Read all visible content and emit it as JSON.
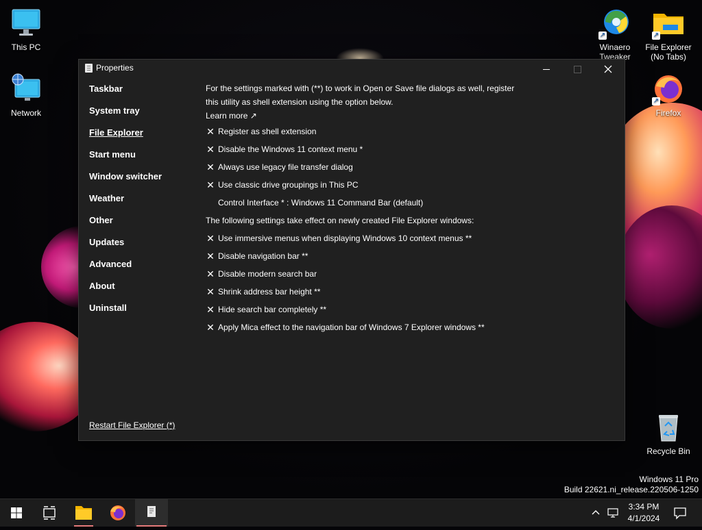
{
  "desktop": {
    "icons": [
      {
        "label": "This PC"
      },
      {
        "label": "Network"
      },
      {
        "label": "Winaero Tweaker"
      },
      {
        "label": "File Explorer (No Tabs)"
      },
      {
        "label": "Firefox"
      },
      {
        "label": "Recycle Bin"
      }
    ],
    "watermark": {
      "line1": "Windows 11 Pro",
      "line2": "Build 22621.ni_release.220506-1250"
    }
  },
  "window": {
    "title": "Properties",
    "nav": [
      {
        "label": "Taskbar",
        "active": false
      },
      {
        "label": "System tray",
        "active": false
      },
      {
        "label": "File Explorer",
        "active": true
      },
      {
        "label": "Start menu",
        "active": false
      },
      {
        "label": "Window switcher",
        "active": false
      },
      {
        "label": "Weather",
        "active": false
      },
      {
        "label": "Other",
        "active": false
      },
      {
        "label": "Updates",
        "active": false
      },
      {
        "label": "Advanced",
        "active": false
      },
      {
        "label": "About",
        "active": false
      },
      {
        "label": "Uninstall",
        "active": false
      }
    ],
    "restart_link": "Restart File Explorer (*)",
    "content": {
      "intro": "For the settings marked with (**) to work in Open or Save file dialogs as well, register this utility as shell extension using the option below.",
      "learn_more": "Learn more ↗",
      "group1": [
        {
          "label": "Register as shell extension",
          "mark": "✕"
        },
        {
          "label": "Disable the Windows 11 context menu *",
          "mark": "✕"
        },
        {
          "label": "Always use legacy file transfer dialog",
          "mark": "✕"
        },
        {
          "label": "Use classic drive groupings in This PC",
          "mark": "✕"
        }
      ],
      "control_interface": "Control Interface * : Windows 11 Command Bar (default)",
      "section2_heading": "The following settings take effect on newly created File Explorer windows:",
      "group2": [
        {
          "label": "Use immersive menus when displaying Windows 10 context menus **",
          "mark": "✕"
        },
        {
          "label": "Disable navigation bar **",
          "mark": "✕"
        },
        {
          "label": "Disable modern search bar",
          "mark": "✕"
        },
        {
          "label": "Shrink address bar height **",
          "mark": "✕"
        },
        {
          "label": "Hide search bar completely **",
          "mark": "✕"
        },
        {
          "label": "Apply Mica effect to the navigation bar of Windows 7 Explorer windows **",
          "mark": "✕"
        }
      ]
    }
  },
  "taskbar": {
    "time": "3:34 PM",
    "date": "4/1/2024",
    "tray_chevron": "^"
  },
  "colors": {
    "window_bg": "#202020",
    "taskbar_bg": "#1c1c1c",
    "active_indicator": "#e47a7a"
  }
}
